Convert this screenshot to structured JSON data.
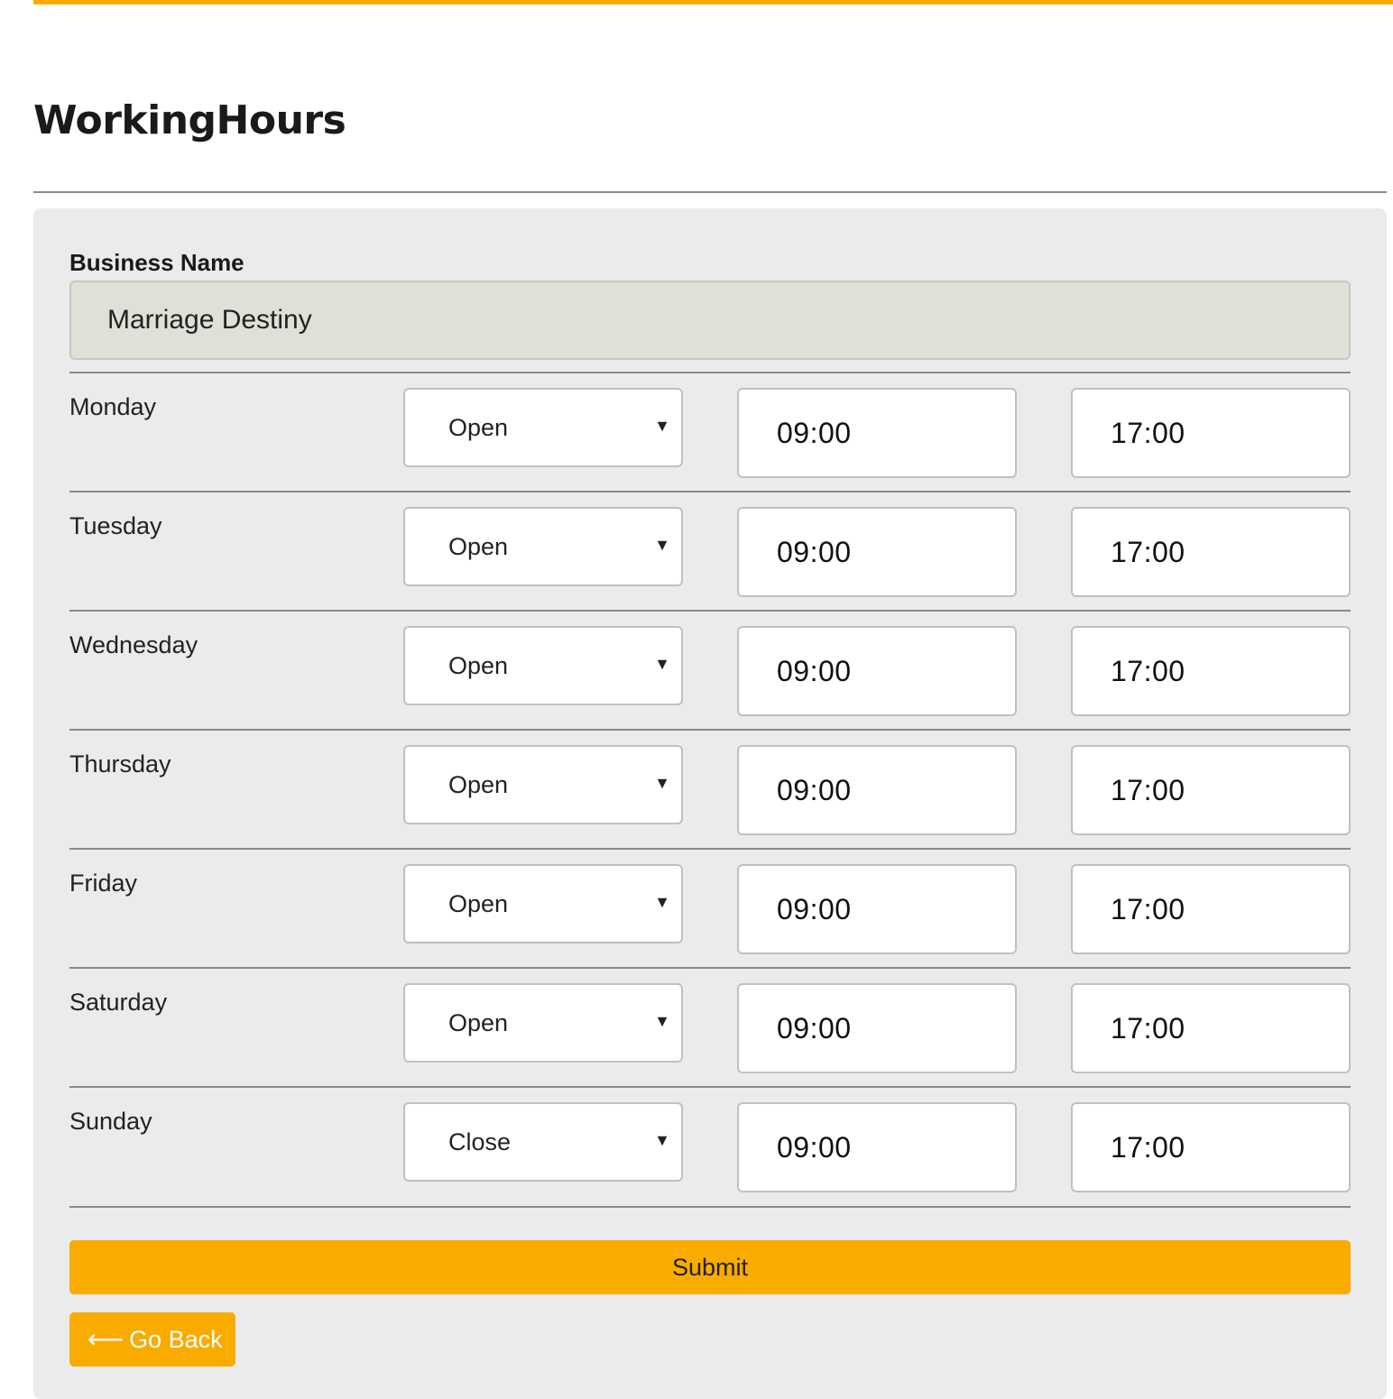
{
  "page": {
    "title": "WorkingHours"
  },
  "form": {
    "business_name_label": "Business Name",
    "business_name_value": "Marriage Destiny",
    "days": [
      {
        "day": "Monday",
        "status": "Open",
        "start": "09:00",
        "end": "17:00"
      },
      {
        "day": "Tuesday",
        "status": "Open",
        "start": "09:00",
        "end": "17:00"
      },
      {
        "day": "Wednesday",
        "status": "Open",
        "start": "09:00",
        "end": "17:00"
      },
      {
        "day": "Thursday",
        "status": "Open",
        "start": "09:00",
        "end": "17:00"
      },
      {
        "day": "Friday",
        "status": "Open",
        "start": "09:00",
        "end": "17:00"
      },
      {
        "day": "Saturday",
        "status": "Open",
        "start": "09:00",
        "end": "17:00"
      },
      {
        "day": "Sunday",
        "status": "Close",
        "start": "09:00",
        "end": "17:00"
      }
    ],
    "submit_label": "Submit",
    "back_label": "Go Back",
    "back_icon": "left-arrow-icon"
  },
  "colors": {
    "accent": "#f9ab00",
    "panel_bg": "#ebebeb",
    "readonly_input_bg": "#e0e0d8"
  }
}
